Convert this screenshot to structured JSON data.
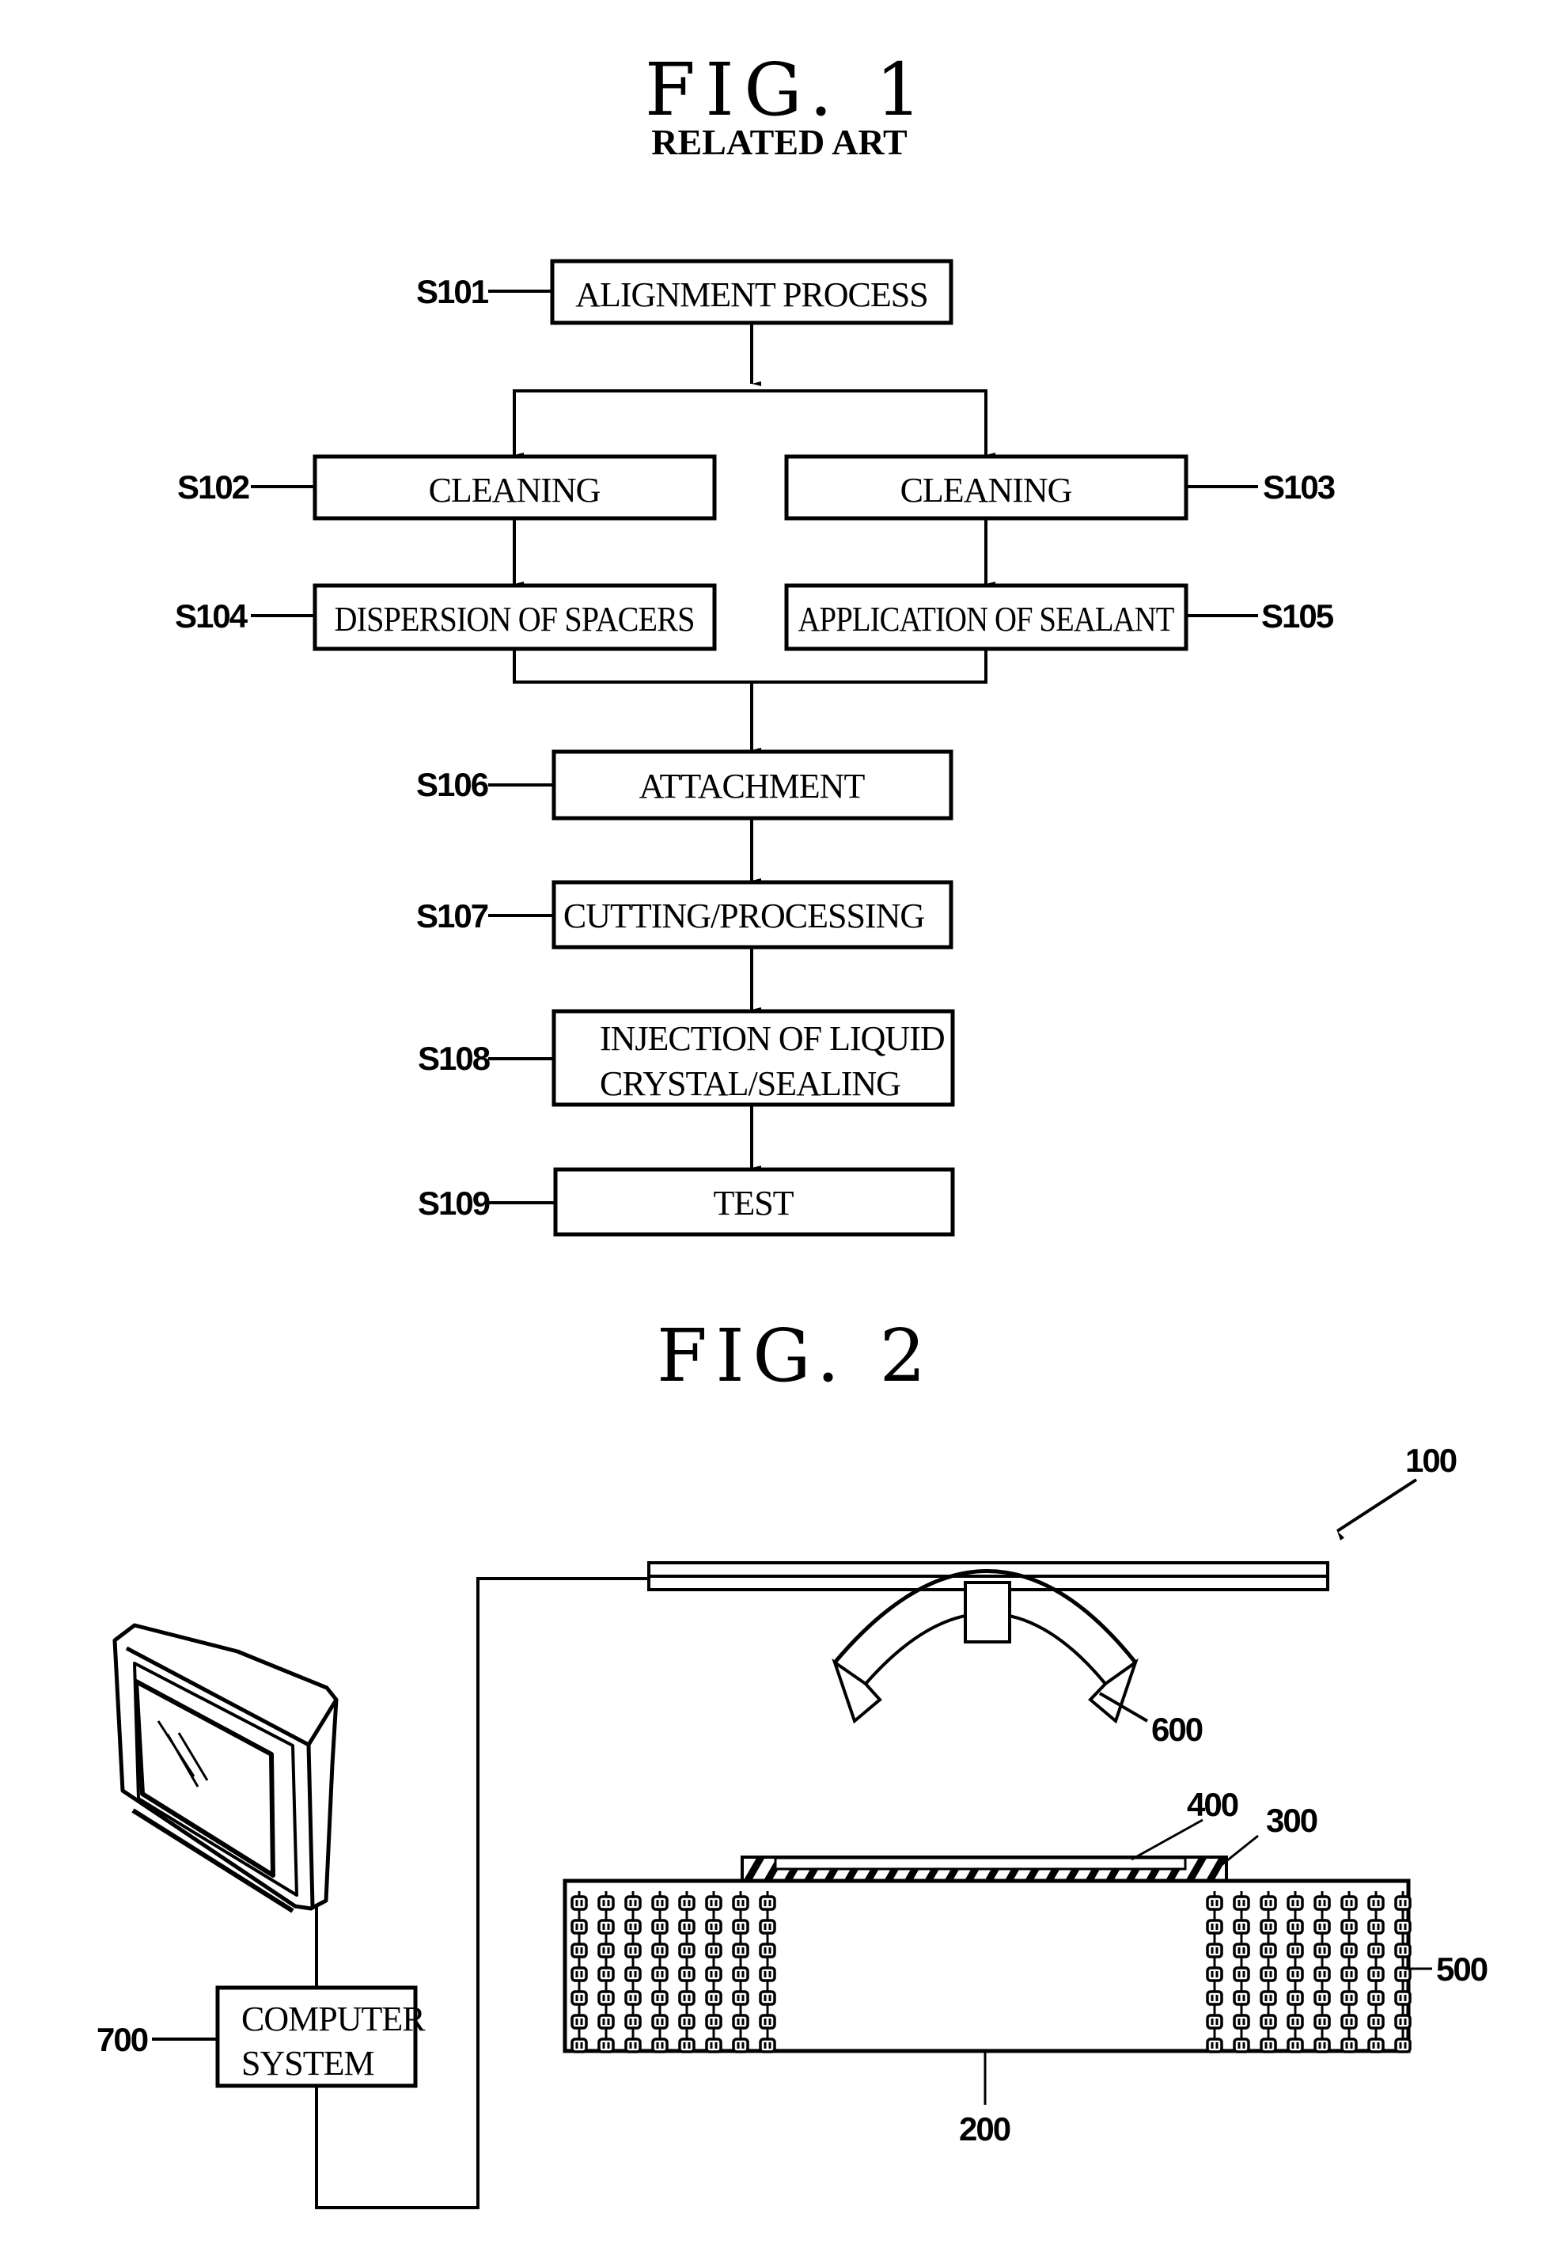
{
  "fig1": {
    "title": "FIG. 1",
    "subtitle": "RELATED ART",
    "steps": [
      {
        "id": "S101",
        "label": "ALIGNMENT PROCESS"
      },
      {
        "id": "S102",
        "label": "CLEANING"
      },
      {
        "id": "S103",
        "label": "CLEANING"
      },
      {
        "id": "S104",
        "label": "DISPERSION OF SPACERS"
      },
      {
        "id": "S105",
        "label": "APPLICATION OF SEALANT"
      },
      {
        "id": "S106",
        "label": "ATTACHMENT"
      },
      {
        "id": "S107",
        "label": "CUTTING/PROCESSING"
      },
      {
        "id": "S108",
        "label_line1": "INJECTION OF LIQUID",
        "label_line2": "CRYSTAL/SEALING"
      },
      {
        "id": "S109",
        "label": "TEST"
      }
    ]
  },
  "fig2": {
    "title": "FIG. 2",
    "refs": {
      "apparatus": "100",
      "stage": "200",
      "sealant": "300",
      "substrate": "400",
      "heater": "500",
      "uv_lamp": "600",
      "computer": "700"
    },
    "computer_label_line1": "COMPUTER",
    "computer_label_line2": "SYSTEM"
  }
}
